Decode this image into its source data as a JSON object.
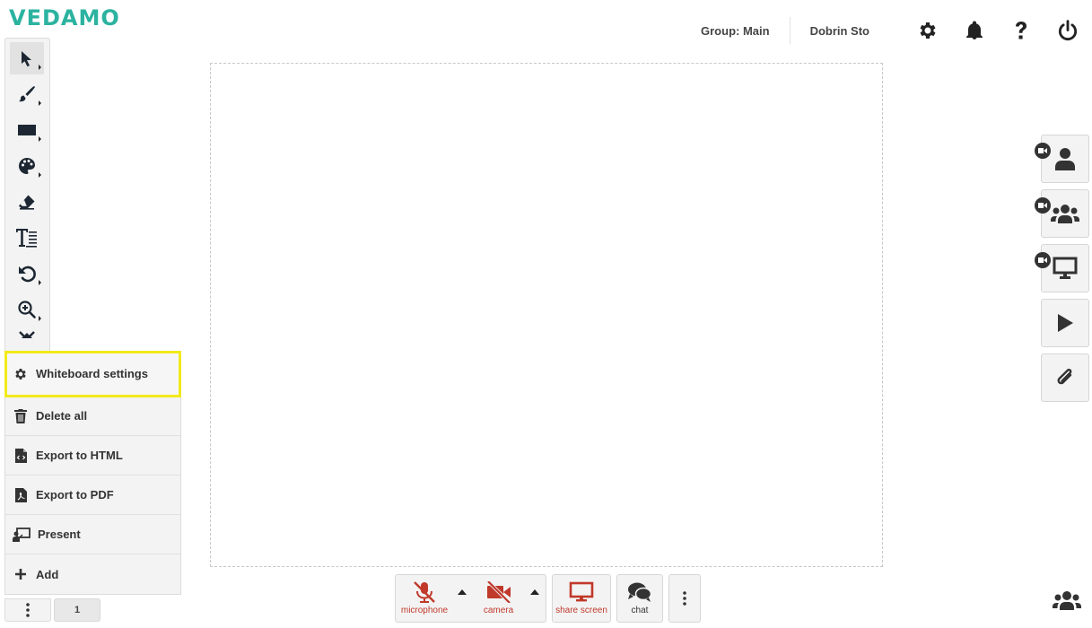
{
  "brand": {
    "logo_text": "VEDAMO",
    "color": "#2bb3a0"
  },
  "header": {
    "group_label": "Group: Main",
    "user_name": "Dobrin Sto",
    "icons": [
      "gear-icon",
      "bell-icon",
      "question-icon",
      "power-icon"
    ]
  },
  "toolbar": {
    "tools": [
      "pointer",
      "brush",
      "shape",
      "color-palette",
      "eraser",
      "text",
      "undo",
      "zoom",
      "collapse"
    ],
    "active_tool": "pointer"
  },
  "menu": {
    "items": [
      {
        "label": "Whiteboard settings",
        "icon": "gear-icon",
        "highlighted": true
      },
      {
        "label": "Delete all",
        "icon": "trash-icon"
      },
      {
        "label": "Export to HTML",
        "icon": "html-file-icon"
      },
      {
        "label": "Export to PDF",
        "icon": "pdf-file-icon"
      },
      {
        "label": "Present",
        "icon": "present-icon"
      },
      {
        "label": "Add",
        "icon": "plus-icon"
      }
    ],
    "highlight_color": "#f2ea1a"
  },
  "pager": {
    "current_page": "1"
  },
  "media_controls": {
    "microphone_label": "microphone",
    "camera_label": "camera",
    "share_screen_label": "share screen",
    "chat_label": "chat",
    "off_color": "#c0392b"
  },
  "side_panel": {
    "buttons": [
      "single-video-icon",
      "group-video-icon",
      "screen-video-icon",
      "play-icon",
      "attachment-icon"
    ]
  },
  "participants_icon": "people-icon"
}
